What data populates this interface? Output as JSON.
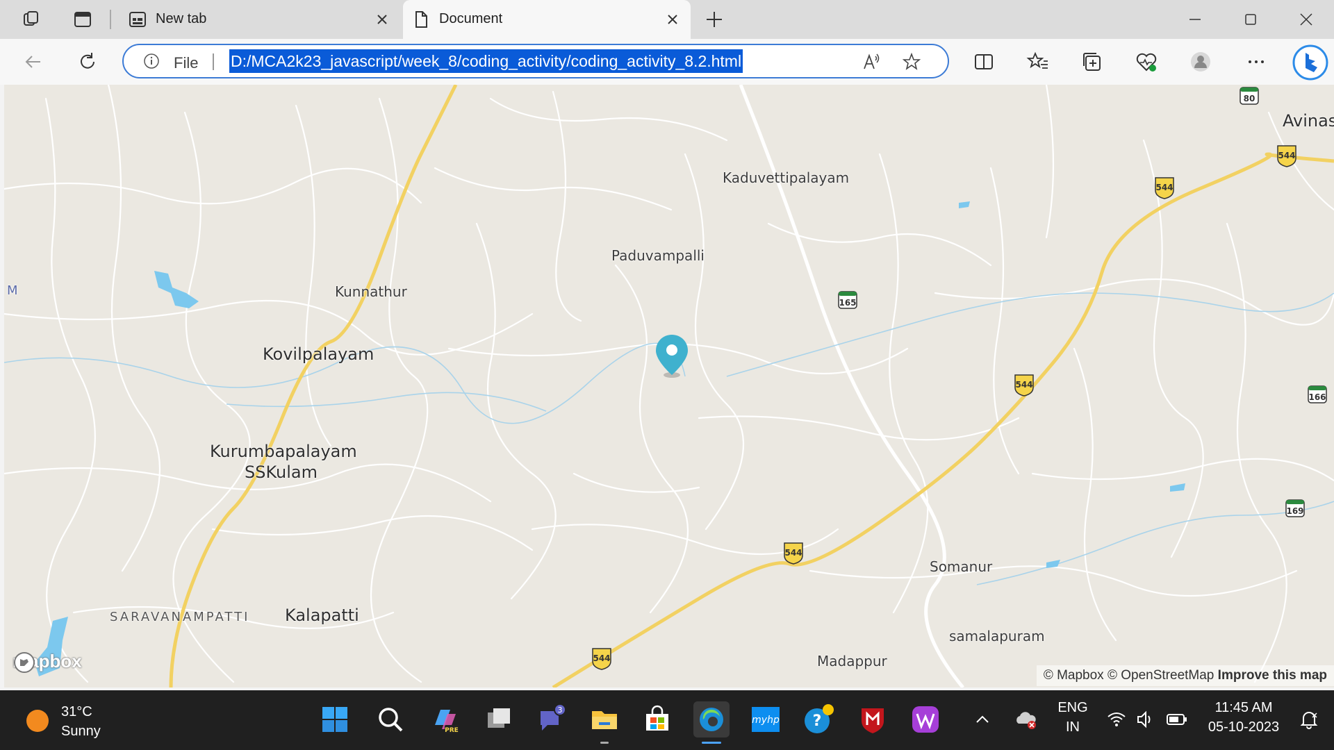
{
  "browser": {
    "tabs": [
      {
        "label": "New tab",
        "active": false
      },
      {
        "label": "Document",
        "active": true
      }
    ],
    "address": {
      "scheme_label": "File",
      "url": "D:/MCA2k23_javascript/week_8/coding_activity/coding_activity_8.2.html"
    }
  },
  "map": {
    "places": {
      "kaduvettipalayam": "Kaduvettipalayam",
      "paduvampalli": "Paduvampalli",
      "kunnathur": "Kunnathur",
      "kovilpalayam": "Kovilpalayam",
      "kurumbapalayam": "Kurumbapalayam",
      "sskulam": "SSKulam",
      "saravanampatti": "SARAVANAMPATTI",
      "kalapatti": "Kalapatti",
      "somanur": "Somanur",
      "samalapuram": "samalapuram",
      "madappur": "Madappur",
      "avinashi_partial": "Avinas",
      "m_partial": "M"
    },
    "highways": [
      "544",
      "544",
      "544",
      "544",
      "544",
      "165",
      "166",
      "169",
      "80"
    ],
    "logo": "mapbox",
    "attribution": {
      "mapbox": "© Mapbox",
      "osm": "© OpenStreetMap",
      "improve": "Improve this map"
    }
  },
  "taskbar": {
    "weather": {
      "temp": "31°C",
      "condition": "Sunny"
    },
    "teams_badge": "3",
    "lang_1": "ENG",
    "lang_2": "IN",
    "time": "11:45 AM",
    "date": "05-10-2023"
  },
  "colors": {
    "map_bg": "#ebe8e1",
    "highway": "#f2d162",
    "water": "#7cc8ee",
    "marker": "#3fb1ce",
    "selection": "#0a5bd8"
  }
}
